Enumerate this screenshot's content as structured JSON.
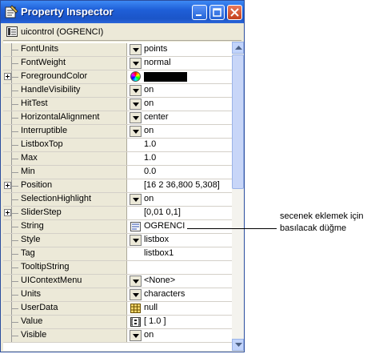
{
  "window": {
    "title": "Property Inspector",
    "object_label": "uicontrol (OGRENCI)",
    "buttons": [
      "minimize",
      "maximize",
      "close"
    ]
  },
  "properties": [
    {
      "name": "FontUnits",
      "value": "points",
      "control": "dropdown"
    },
    {
      "name": "FontWeight",
      "value": "normal",
      "control": "dropdown"
    },
    {
      "name": "ForegroundColor",
      "value": "",
      "control": "color",
      "expandable": true,
      "color": "#000000"
    },
    {
      "name": "HandleVisibility",
      "value": "on",
      "control": "dropdown"
    },
    {
      "name": "HitTest",
      "value": "on",
      "control": "dropdown"
    },
    {
      "name": "HorizontalAlignment",
      "value": "center",
      "control": "dropdown"
    },
    {
      "name": "Interruptible",
      "value": "on",
      "control": "dropdown"
    },
    {
      "name": "ListboxTop",
      "value": "1.0",
      "control": "text"
    },
    {
      "name": "Max",
      "value": "1.0",
      "control": "text"
    },
    {
      "name": "Min",
      "value": "0.0",
      "control": "text"
    },
    {
      "name": "Position",
      "value": "[16 2 36,800 5,308]",
      "control": "text",
      "expandable": true
    },
    {
      "name": "SelectionHighlight",
      "value": "on",
      "control": "dropdown"
    },
    {
      "name": "SliderStep",
      "value": "[0,01 0,1]",
      "control": "text",
      "expandable": true
    },
    {
      "name": "String",
      "value": "OGRENCI",
      "control": "string"
    },
    {
      "name": "Style",
      "value": "listbox",
      "control": "dropdown"
    },
    {
      "name": "Tag",
      "value": "listbox1",
      "control": "text"
    },
    {
      "name": "TooltipString",
      "value": "",
      "control": "text"
    },
    {
      "name": "UIContextMenu",
      "value": "<None>",
      "control": "dropdown"
    },
    {
      "name": "Units",
      "value": "characters",
      "control": "dropdown"
    },
    {
      "name": "UserData",
      "value": "null",
      "control": "table"
    },
    {
      "name": "Value",
      "value": "[ 1.0 ]",
      "control": "matrix"
    },
    {
      "name": "Visible",
      "value": "on",
      "control": "dropdown"
    }
  ],
  "annotation": {
    "line1": "secenek eklemek için",
    "line2": "basılacak düğme"
  }
}
